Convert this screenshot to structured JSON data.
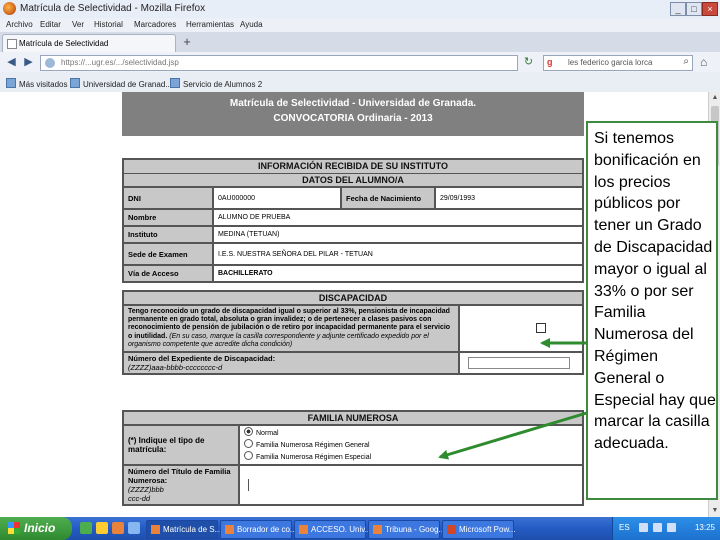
{
  "window": {
    "title": "Matrícula de Selectividad - Mozilla Firefox"
  },
  "menu": [
    "Archivo",
    "Editar",
    "Ver",
    "Historial",
    "Marcadores",
    "Herramientas",
    "Ayuda"
  ],
  "tab": {
    "label": "Matrícula de Selectividad"
  },
  "nav": {
    "url": "https://...ugr.es/.../selectividad.jsp",
    "search_text": "les federico garcia lorca"
  },
  "bookmarks": [
    "Más visitados",
    "Universidad de Granad...",
    "Servicio de Alumnos 2"
  ],
  "page": {
    "header_line1": "Matrícula de Selectividad - Universidad de Granada.",
    "header_line2": "CONVOCATORIA Ordinaria - 2013",
    "info_title": "INFORMACIÓN RECIBIDA DE SU INSTITUTO",
    "student_title": "DATOS DEL ALUMNO/A",
    "dni_label": "DNI",
    "dni_value": "0AU000000",
    "birth_label": "Fecha de Nacimiento",
    "birth_value": "29/09/1993",
    "name_label": "Nombre",
    "name_value": "ALUMNO DE PRUEBA",
    "institute_label": "Instituto",
    "institute_value": "MEDINA (TETUAN)",
    "exam_label": "Sede de Examen",
    "exam_value": "I.E.S. NUESTRA SEÑORA DEL PILAR - TETUAN",
    "access_label": "Vía de Acceso",
    "access_value": "BACHILLERATO",
    "disability_title": "DISCAPACIDAD",
    "disability_text": "Tengo reconocido un grado de discapacidad igual o superior al 33%, pensionista de incapacidad permanente en grado total, absoluta o gran invalidez; o de pertenecer a clases pasivos con reconocimiento de pensión de jubilación o de retiro por incapacidad permanente para el servicio o inutilidad.",
    "disability_note": "(En su caso, marque la casilla correspondiente y adjunte certificado expedido por el organismo competente que acredite dicha condición)",
    "disability_file_label": "Número del Expediente de Discapacidad:",
    "disability_file_format": "(ZZZZ)aaa-bbbb-cccccccc-d",
    "family_title": "FAMILIA NUMEROSA",
    "family_type_label": "(*) Indique el tipo de matrícula:",
    "family_options": [
      "Normal",
      "Familia Numerosa Régimen General",
      "Familia Numerosa Régimen Especial"
    ],
    "family_selected": "Normal",
    "family_title_label": "Número del Título de Familia Numerosa:",
    "family_title_format": "(ZZZZ)bbb\nccc-dd"
  },
  "callout": {
    "text": "Si tenemos bonificación en los precios públicos por tener un Grado de Discapacidad mayor o igual al 33% o por ser Familia Numerosa del Régimen General o Especial hay que marcar la casilla adecuada.",
    "arrow_color": "#2e8b2e",
    "border_color": "#3f8a3f"
  },
  "taskbar": {
    "start_label": "Inicio",
    "buttons": [
      "Matrícula de S...",
      "Borrador de co...",
      "ACCESO. Univ...",
      "Tribuna - Goog...",
      "Microsoft Pow..."
    ],
    "language": "ES",
    "clock": "13:25"
  }
}
